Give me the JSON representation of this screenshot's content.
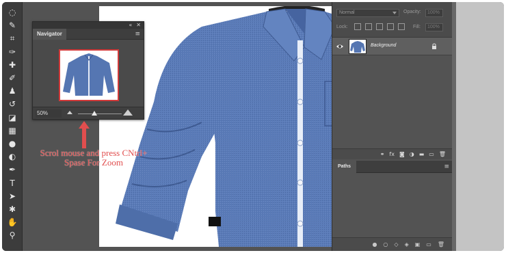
{
  "toolbar": {
    "tools": [
      {
        "name": "lasso-tool",
        "glyph": "◌"
      },
      {
        "name": "quick-select-tool",
        "glyph": "✎"
      },
      {
        "name": "crop-tool",
        "glyph": "⌗"
      },
      {
        "name": "eyedropper-tool",
        "glyph": "✑"
      },
      {
        "name": "healing-brush-tool",
        "glyph": "✚"
      },
      {
        "name": "brush-tool",
        "glyph": "✐"
      },
      {
        "name": "clone-stamp-tool",
        "glyph": "♟"
      },
      {
        "name": "history-brush-tool",
        "glyph": "↺"
      },
      {
        "name": "eraser-tool",
        "glyph": "◪"
      },
      {
        "name": "gradient-tool",
        "glyph": "▦"
      },
      {
        "name": "blur-tool",
        "glyph": "●"
      },
      {
        "name": "dodge-tool",
        "glyph": "◐"
      },
      {
        "name": "pen-tool",
        "glyph": "✒"
      },
      {
        "name": "type-tool",
        "glyph": "T"
      },
      {
        "name": "path-selection-tool",
        "glyph": "➤"
      },
      {
        "name": "shape-tool",
        "glyph": "✱"
      },
      {
        "name": "hand-tool",
        "glyph": "✋"
      },
      {
        "name": "zoom-tool",
        "glyph": "⚲"
      }
    ]
  },
  "navigator": {
    "title": "Navigator",
    "menu_glyph": "≡",
    "collapse_glyph": "«",
    "close_glyph": "✕",
    "zoom_value": "50%"
  },
  "annotation": {
    "line1": "Scrol mouse and press CNtrl+",
    "line2": "Spase For Zoom",
    "color": "#e14e4e"
  },
  "layers": {
    "blend_mode": "Normal",
    "opacity_label": "Opacity:",
    "opacity_value": "100%",
    "lock_label": "Lock:",
    "fill_label": "Fill:",
    "fill_value": "100%",
    "layer_name": "Background",
    "footer_glyphs": [
      "⚭",
      "fx",
      "◙",
      "◑",
      "▬",
      "▭",
      "🗑"
    ]
  },
  "paths": {
    "title": "Paths",
    "menu_glyph": "≡",
    "footer_glyphs": [
      "●",
      "○",
      "◇",
      "◈",
      "▣",
      "▭",
      "🗑"
    ]
  },
  "colors": {
    "app_bg": "#535353",
    "panel_dark": "#3c3c3c",
    "shirt_blue": "#5577b3",
    "accent_red": "#d23a3a"
  }
}
